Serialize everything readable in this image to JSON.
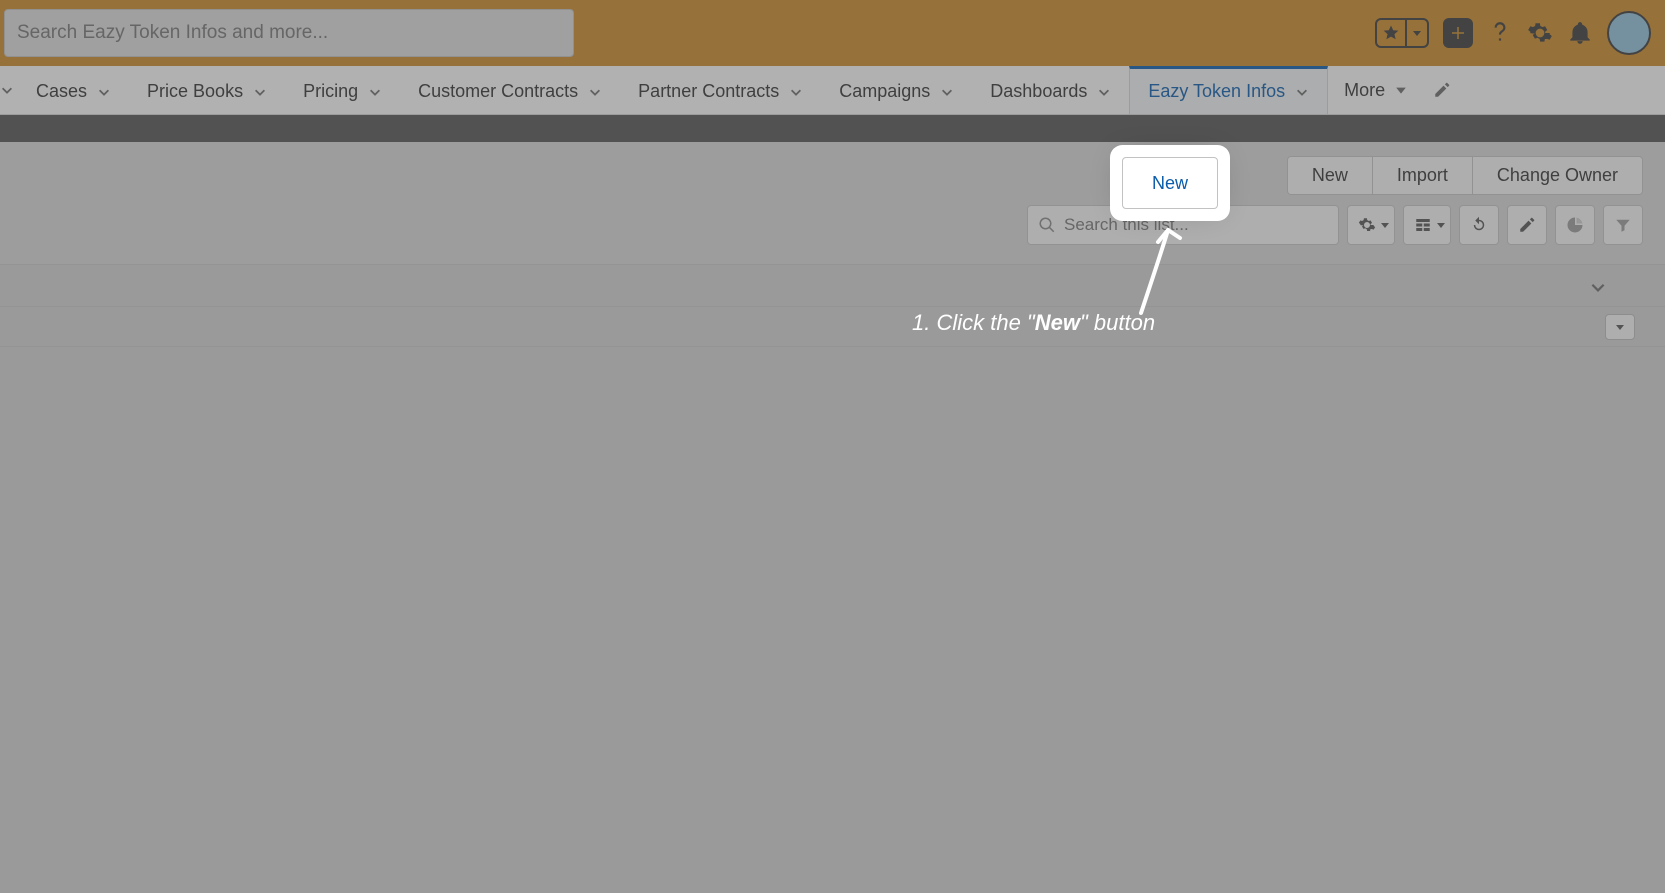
{
  "global": {
    "search_placeholder": "Search Eazy Token Infos and more...",
    "icons": {
      "favorites": "favorites",
      "favorites_dd": "favorites-menu",
      "add": "global-add",
      "help": "help",
      "setup": "setup",
      "notifications": "notifications",
      "avatar": "avatar"
    }
  },
  "nav": {
    "items": [
      {
        "label": "Cases"
      },
      {
        "label": "Price Books"
      },
      {
        "label": "Pricing"
      },
      {
        "label": "Customer Contracts"
      },
      {
        "label": "Partner Contracts"
      },
      {
        "label": "Campaigns"
      },
      {
        "label": "Dashboards"
      },
      {
        "label": "Eazy Token Infos",
        "active": true
      }
    ],
    "more_label": "More",
    "edit_nav": "edit-nav"
  },
  "list": {
    "actions": {
      "new": "New",
      "import": "Import",
      "change_owner": "Change Owner"
    },
    "search_placeholder": "Search this list...",
    "tool_icons": {
      "list_settings": "list-view-controls",
      "display_as": "display-as",
      "refresh": "refresh",
      "edit": "inline-edit",
      "chart": "chart",
      "filter": "filter"
    }
  },
  "annotation": {
    "prefix": "1. Click the \"",
    "bold": "New",
    "suffix": "\" button"
  }
}
